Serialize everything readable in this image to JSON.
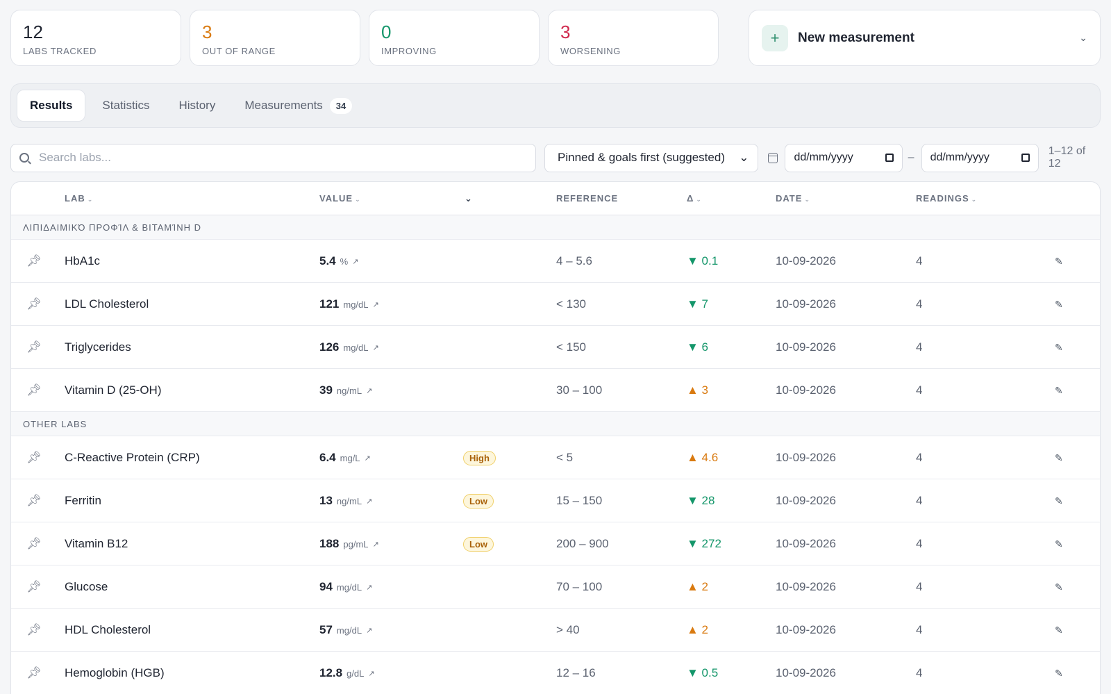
{
  "stats": [
    {
      "value": "12",
      "label": "Labs tracked",
      "color": "#1f2430"
    },
    {
      "value": "3",
      "label": "Out of range",
      "color": "#d97a10"
    },
    {
      "value": "0",
      "label": "Improving",
      "color": "#14966a"
    },
    {
      "value": "3",
      "label": "Worsening",
      "color": "#d0294d"
    }
  ],
  "new_measurement": {
    "label": "New measurement",
    "plus": "+",
    "chevron": "⌄"
  },
  "tabs": [
    {
      "label": "Results",
      "active": true
    },
    {
      "label": "Statistics"
    },
    {
      "label": "History"
    },
    {
      "label": "Measurements",
      "badge": "34"
    }
  ],
  "filters": {
    "search_placeholder": "Search labs...",
    "sort": "Pinned & goals first (suggested)",
    "date_from": "dd/mm/yyyy",
    "date_sep": "–",
    "date_to": "dd/mm/yyyy",
    "range": "1–12 of 12"
  },
  "table": {
    "headers": {
      "lab": "Lab",
      "value": "Value",
      "reference": "Reference",
      "delta": "Δ",
      "date": "Date",
      "readings": "Readings"
    },
    "groups": [
      {
        "title": "ΛΙΠΙΔΑΙΜΙΚΌ ΠΡΟΦΊΛ & ΒΙΤΑΜΊΝΗ D",
        "rows": [
          {
            "lab": "HbA1c",
            "value": "5.4",
            "unit": "%",
            "flag": "",
            "ref": "4 – 5.6",
            "delta": "▼ 0.1",
            "dir": "down",
            "date": "10-09-2026",
            "readings": "4"
          },
          {
            "lab": "LDL Cholesterol",
            "value": "121",
            "unit": "mg/dL",
            "flag": "",
            "ref": "< 130",
            "delta": "▼ 7",
            "dir": "down",
            "date": "10-09-2026",
            "readings": "4"
          },
          {
            "lab": "Triglycerides",
            "value": "126",
            "unit": "mg/dL",
            "flag": "",
            "ref": "< 150",
            "delta": "▼ 6",
            "dir": "down",
            "date": "10-09-2026",
            "readings": "4"
          },
          {
            "lab": "Vitamin D (25-OH)",
            "value": "39",
            "unit": "ng/mL",
            "flag": "",
            "ref": "30 – 100",
            "delta": "▲ 3",
            "dir": "up",
            "date": "10-09-2026",
            "readings": "4"
          }
        ]
      },
      {
        "title": "OTHER LABS",
        "rows": [
          {
            "lab": "C-Reactive Protein (CRP)",
            "value": "6.4",
            "unit": "mg/L",
            "flag": "High",
            "ref": "< 5",
            "delta": "▲ 4.6",
            "dir": "up",
            "date": "10-09-2026",
            "readings": "4"
          },
          {
            "lab": "Ferritin",
            "value": "13",
            "unit": "ng/mL",
            "flag": "Low",
            "ref": "15 – 150",
            "delta": "▼ 28",
            "dir": "down",
            "date": "10-09-2026",
            "readings": "4"
          },
          {
            "lab": "Vitamin B12",
            "value": "188",
            "unit": "pg/mL",
            "flag": "Low",
            "ref": "200 – 900",
            "delta": "▼ 272",
            "dir": "down",
            "date": "10-09-2026",
            "readings": "4"
          },
          {
            "lab": "Glucose",
            "value": "94",
            "unit": "mg/dL",
            "flag": "",
            "ref": "70 – 100",
            "delta": "▲ 2",
            "dir": "up",
            "date": "10-09-2026",
            "readings": "4"
          },
          {
            "lab": "HDL Cholesterol",
            "value": "57",
            "unit": "mg/dL",
            "flag": "",
            "ref": "> 40",
            "delta": "▲ 2",
            "dir": "up",
            "date": "10-09-2026",
            "readings": "4"
          },
          {
            "lab": "Hemoglobin (HGB)",
            "value": "12.8",
            "unit": "g/dL",
            "flag": "",
            "ref": "12 – 16",
            "delta": "▼ 0.5",
            "dir": "down",
            "date": "10-09-2026",
            "readings": "4"
          }
        ]
      }
    ]
  }
}
